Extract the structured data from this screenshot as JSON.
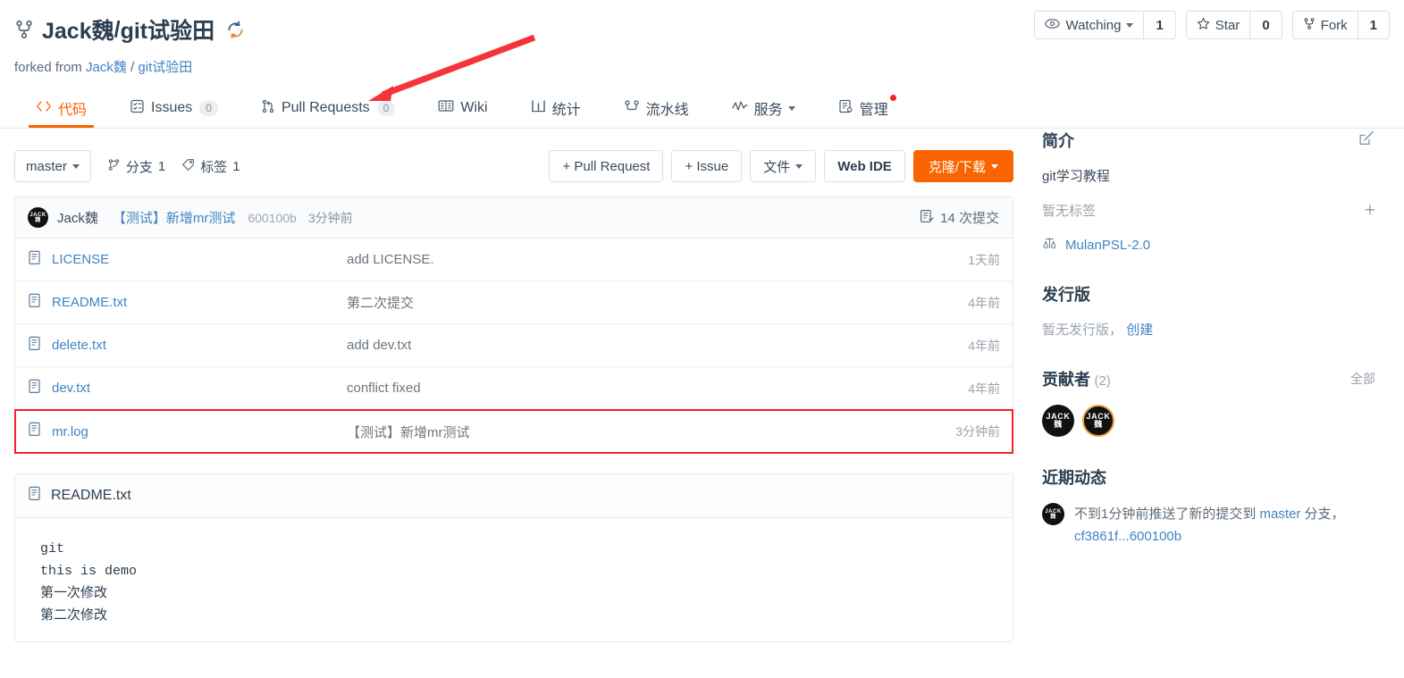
{
  "header": {
    "owner": "Jack魏",
    "separator": "/",
    "repo": "git试验田",
    "forked_from_prefix": "forked from",
    "forked_owner": "Jack魏",
    "forked_separator": "/",
    "forked_repo": "git试验田"
  },
  "top_actions": {
    "watching_label": "Watching",
    "watching_count": "1",
    "star_label": "Star",
    "star_count": "0",
    "fork_label": "Fork",
    "fork_count": "1"
  },
  "nav": {
    "tabs": [
      {
        "label": "代码",
        "badge": "",
        "icon": "code-icon",
        "active": true
      },
      {
        "label": "Issues",
        "badge": "0",
        "icon": "issues-icon",
        "active": false
      },
      {
        "label": "Pull Requests",
        "badge": "0",
        "icon": "pull-request-icon",
        "active": false
      },
      {
        "label": "Wiki",
        "badge": "",
        "icon": "wiki-icon",
        "active": false
      },
      {
        "label": "统计",
        "badge": "",
        "icon": "stats-icon",
        "active": false
      },
      {
        "label": "流水线",
        "badge": "",
        "icon": "pipeline-icon",
        "active": false
      },
      {
        "label": "服务",
        "badge": "",
        "icon": "service-icon",
        "active": false
      },
      {
        "label": "管理",
        "badge": "",
        "icon": "manage-icon",
        "active": false
      }
    ]
  },
  "toolbar": {
    "branch": "master",
    "branches_label": "分支",
    "branches_count": "1",
    "tags_label": "标签",
    "tags_count": "1",
    "pull_request_btn": "+ Pull Request",
    "issue_btn": "+ Issue",
    "files_btn": "文件",
    "webide_btn": "Web IDE",
    "clone_btn": "克隆/下载"
  },
  "commit_bar": {
    "avatar_top": "JACK",
    "avatar_bottom": "魏",
    "author": "Jack魏",
    "message": "【测试】新增mr测试",
    "sha": "600100b",
    "time": "3分钟前",
    "commits_count": "14 次提交"
  },
  "files": [
    {
      "name": "LICENSE",
      "message": "add LICENSE.",
      "time": "1天前",
      "highlight": false
    },
    {
      "name": "README.txt",
      "message": "第二次提交",
      "time": "4年前",
      "highlight": false
    },
    {
      "name": "delete.txt",
      "message": "add dev.txt",
      "time": "4年前",
      "highlight": false
    },
    {
      "name": "dev.txt",
      "message": "conflict fixed",
      "time": "4年前",
      "highlight": false
    },
    {
      "name": "mr.log",
      "message": "【测试】新增mr测试",
      "time": "3分钟前",
      "highlight": true
    }
  ],
  "readme": {
    "title": "README.txt",
    "content": "git\nthis is demo\n第一次修改\n第二次修改"
  },
  "sidebar": {
    "intro_title": "简介",
    "intro_text": "git学习教程",
    "no_tags": "暂无标签",
    "license": "MulanPSL-2.0",
    "release_title": "发行版",
    "no_release": "暂无发行版，",
    "create_release": "创建",
    "contributors_title": "贡献者",
    "contributors_count": "(2)",
    "contributors_all": "全部",
    "contributors": [
      {
        "top": "JACK",
        "bottom": "魏",
        "ring": false
      },
      {
        "top": "JACK",
        "bottom": "魏",
        "ring": true
      }
    ],
    "activity_title": "近期动态",
    "activity_avatar_top": "JACK",
    "activity_avatar_bottom": "魏",
    "activity_text_1": "不到1分钟前推送了新的提交到 ",
    "activity_branch": "master",
    "activity_text_2": " 分支，",
    "activity_sha": "cf3861f...600100b"
  },
  "annotation": {
    "arrow_color": "#f5333a",
    "highlight_color": "#f5222d"
  }
}
